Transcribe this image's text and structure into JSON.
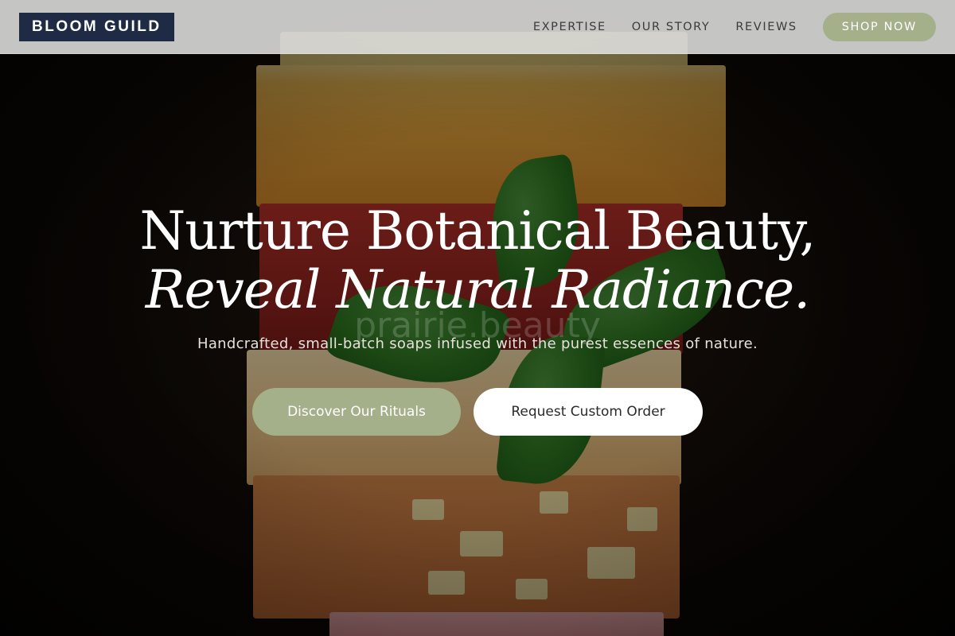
{
  "brand": {
    "logo_text": "BLOOM GUILD"
  },
  "nav": {
    "items": [
      {
        "label": "EXPERTISE"
      },
      {
        "label": "OUR STORY"
      },
      {
        "label": "REVIEWS"
      }
    ],
    "cta_label": "SHOP NOW"
  },
  "hero": {
    "headline_line1": "Nurture Botanical Beauty,",
    "headline_line2": "Reveal Natural Radiance.",
    "watermark": "prairie.beauty",
    "subtitle": "Handcrafted, small-batch soaps infused with the purest essences of nature.",
    "primary_cta": "Discover Our Rituals",
    "secondary_cta": "Request Custom Order"
  },
  "colors": {
    "brand_navy": "#1f2a44",
    "accent_sage": "#a4b08a",
    "header_bg": "#e0e0de"
  }
}
